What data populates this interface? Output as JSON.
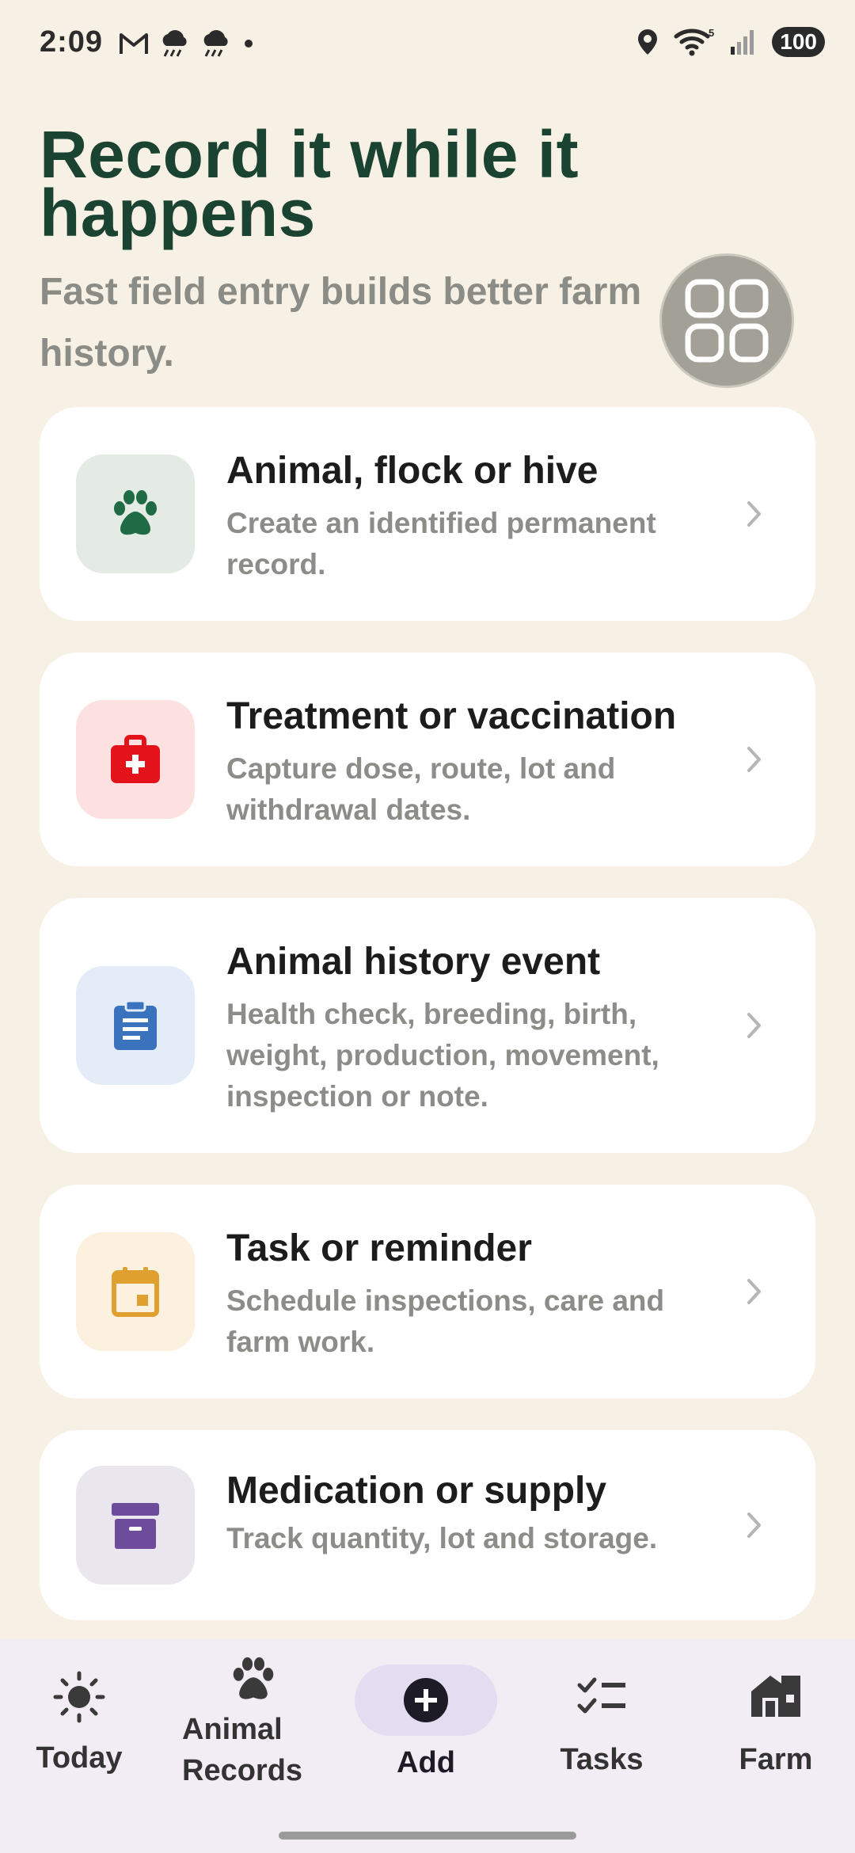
{
  "status_bar": {
    "time": "2:09",
    "battery": "100",
    "left_icons": [
      "gmail-icon",
      "rain-cloud-icon",
      "rain-cloud-icon",
      "dot-icon"
    ],
    "right_icons": [
      "location-icon",
      "wifi-icon",
      "signal-icon",
      "battery-icon"
    ],
    "wifi_label": "5"
  },
  "header": {
    "title": "Record it while it happens",
    "subtitle": "Fast field entry builds better farm history."
  },
  "floating_button": {
    "icon": "grid-menu-icon"
  },
  "cards": [
    {
      "title": "Animal, flock or hive",
      "description": "Create an identified permanent record.",
      "icon": "paw-icon",
      "icon_color": "#1E6B45",
      "icon_bg": "#E4EBE4"
    },
    {
      "title": "Treatment or vaccination",
      "description": "Capture dose, route, lot and withdrawal dates.",
      "icon": "medical-kit-icon",
      "icon_color": "#E3121B",
      "icon_bg": "#FDE1E1"
    },
    {
      "title": "Animal history event",
      "description": "Health check, breeding, birth, weight, production, movement, inspection or note.",
      "icon": "clipboard-icon",
      "icon_color": "#3A72BE",
      "icon_bg": "#E3ECF7"
    },
    {
      "title": "Task or reminder",
      "description": "Schedule inspections, care and farm work.",
      "icon": "calendar-icon",
      "icon_color": "#E0A030",
      "icon_bg": "#FCF0DE"
    },
    {
      "title": "Medication or supply",
      "description": "Track quantity, lot and storage.",
      "icon": "archive-box-icon",
      "icon_color": "#6E4C9C",
      "icon_bg": "#EAE6EE"
    }
  ],
  "bottom_nav": {
    "items": [
      {
        "label": "Today",
        "icon": "sun-icon"
      },
      {
        "label": "Animal Records",
        "line1": "Animal",
        "line2": "Records",
        "icon": "paw-icon"
      },
      {
        "label": "Add",
        "icon": "add-circle-icon",
        "selected": true
      },
      {
        "label": "Tasks",
        "icon": "checklist-icon"
      },
      {
        "label": "Farm",
        "icon": "barn-icon"
      }
    ]
  }
}
